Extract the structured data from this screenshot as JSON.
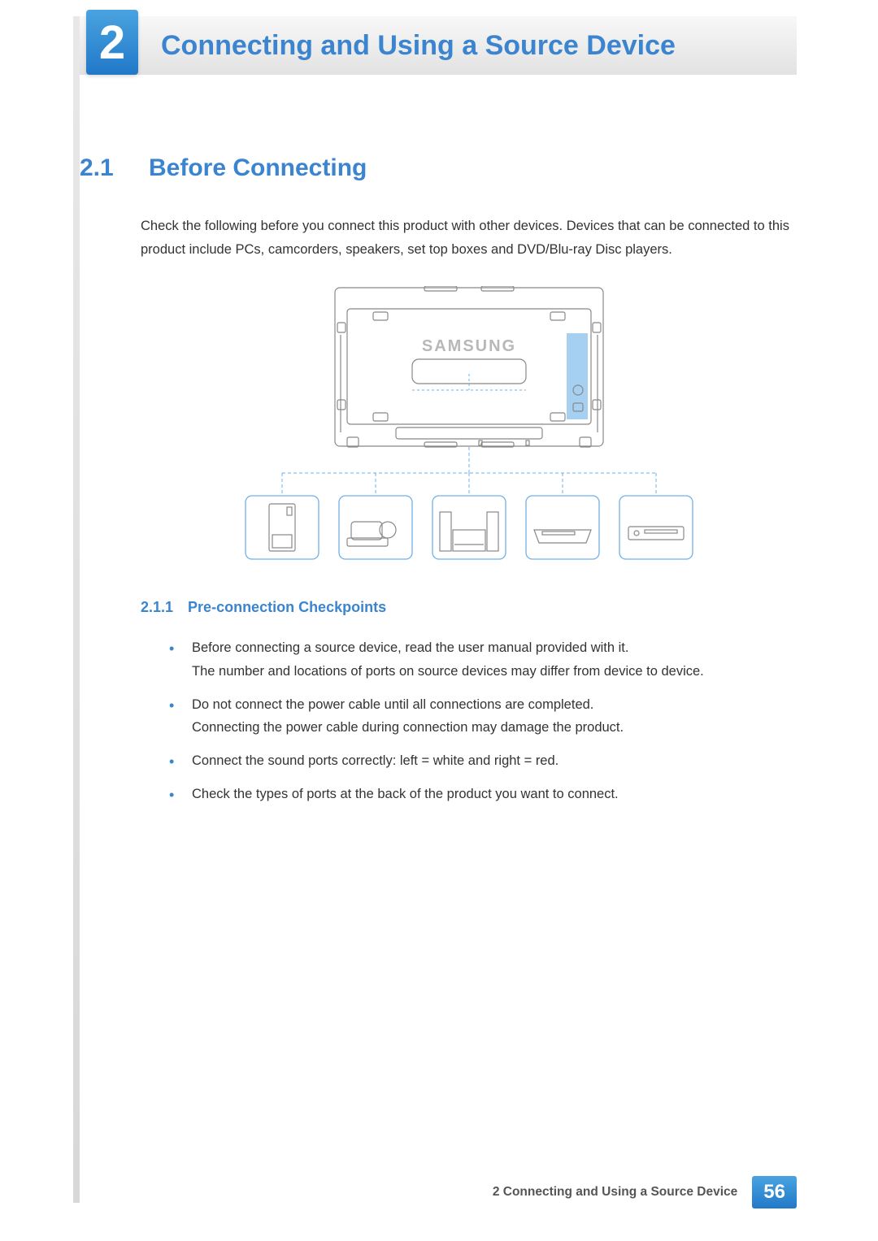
{
  "chapter": {
    "number": "2",
    "title": "Connecting and Using a Source Device"
  },
  "section": {
    "number": "2.1",
    "title": "Before Connecting",
    "intro": "Check the following before you connect this product with other devices. Devices that can be connected to this product include PCs, camcorders, speakers, set top boxes and DVD/Blu-ray Disc players."
  },
  "diagram": {
    "brand": "SAMSUNG",
    "devices": [
      "pc",
      "camcorder",
      "speakers",
      "set-top-box",
      "dvd-bluray"
    ]
  },
  "subsection": {
    "number": "2.1.1",
    "title": "Pre-connection Checkpoints",
    "items": [
      "Before connecting a source device, read the user manual provided with it.\nThe number and locations of ports on source devices may differ from device to device.",
      "Do not connect the power cable until all connections are completed.\nConnecting the power cable during connection may damage the product.",
      "Connect the sound ports correctly: left = white and right = red.",
      "Check the types of ports at the back of the product you want to connect."
    ]
  },
  "footer": {
    "text": "2 Connecting and Using a Source Device",
    "page": "56"
  }
}
